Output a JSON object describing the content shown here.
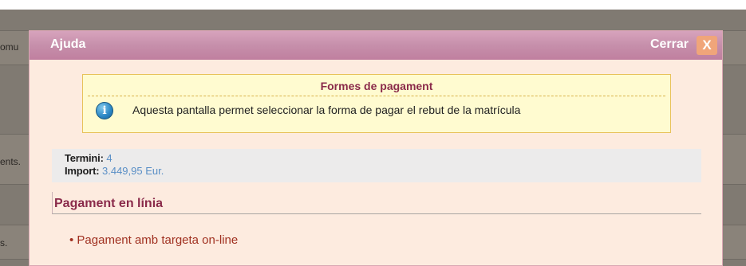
{
  "background": {
    "snippets": [
      "omu",
      "ents.",
      "s."
    ]
  },
  "modal": {
    "title": "Ajuda",
    "close_label": "Cerrar",
    "close_icon_glyph": "X",
    "icon_names": {
      "close": "close-x-icon",
      "info": "info-icon"
    }
  },
  "info": {
    "title": "Formes de pagament",
    "icon_glyph": "i",
    "text": "Aquesta pantalla permet seleccionar la forma de pagar el rebut de la matrícula"
  },
  "summary": {
    "term_label": "Termini:",
    "term_value": "4",
    "import_label": "Import:",
    "import_value": "3.449,95 Eur."
  },
  "section": {
    "title": "Pagament en línia"
  },
  "payment_options": [
    {
      "label": "• Pagament amb targeta on-line"
    }
  ],
  "colors": {
    "header_gradient_top": "#d7a3bd",
    "header_gradient_bottom": "#c07f9f",
    "modal_bg": "#fdebdf",
    "accent_title": "#8a2a4a",
    "value_blue": "#5a8fc6",
    "link_red": "#a03020",
    "info_bg": "#fffbd0",
    "close_bg": "#f0a57a"
  }
}
